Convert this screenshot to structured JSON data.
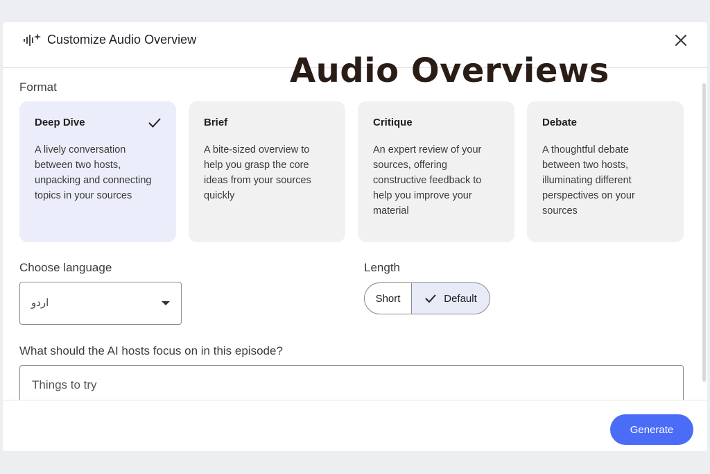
{
  "header": {
    "title": "Customize Audio Overview",
    "icon": "sparkle-waveform-icon",
    "close_icon": "close-icon"
  },
  "overlay_title": "Audio Overviews",
  "format": {
    "label": "Format",
    "cards": [
      {
        "title": "Deep Dive",
        "desc": "A lively conversation between two hosts, unpacking and connecting topics in your sources",
        "selected": true
      },
      {
        "title": "Brief",
        "desc": "A bite-sized overview to help you grasp the core ideas from your sources quickly",
        "selected": false
      },
      {
        "title": "Critique",
        "desc": "An expert review of your sources, offering constructive feedback to help you improve your material",
        "selected": false
      },
      {
        "title": "Debate",
        "desc": "A thoughtful debate between two hosts, illuminating different perspectives on your sources",
        "selected": false
      }
    ]
  },
  "language": {
    "label": "Choose language",
    "value": "اردو"
  },
  "length": {
    "label": "Length",
    "options": [
      "Short",
      "Default"
    ],
    "selected": "Default"
  },
  "focus": {
    "label": "What should the AI hosts focus on in this episode?",
    "placeholder": "Things to try"
  },
  "footer": {
    "generate_label": "Generate"
  },
  "colors": {
    "accent": "#4a6cf7",
    "selected_card": "#ebeefa",
    "card": "#f1f1f1",
    "overlay_title": "#2a1d16"
  }
}
